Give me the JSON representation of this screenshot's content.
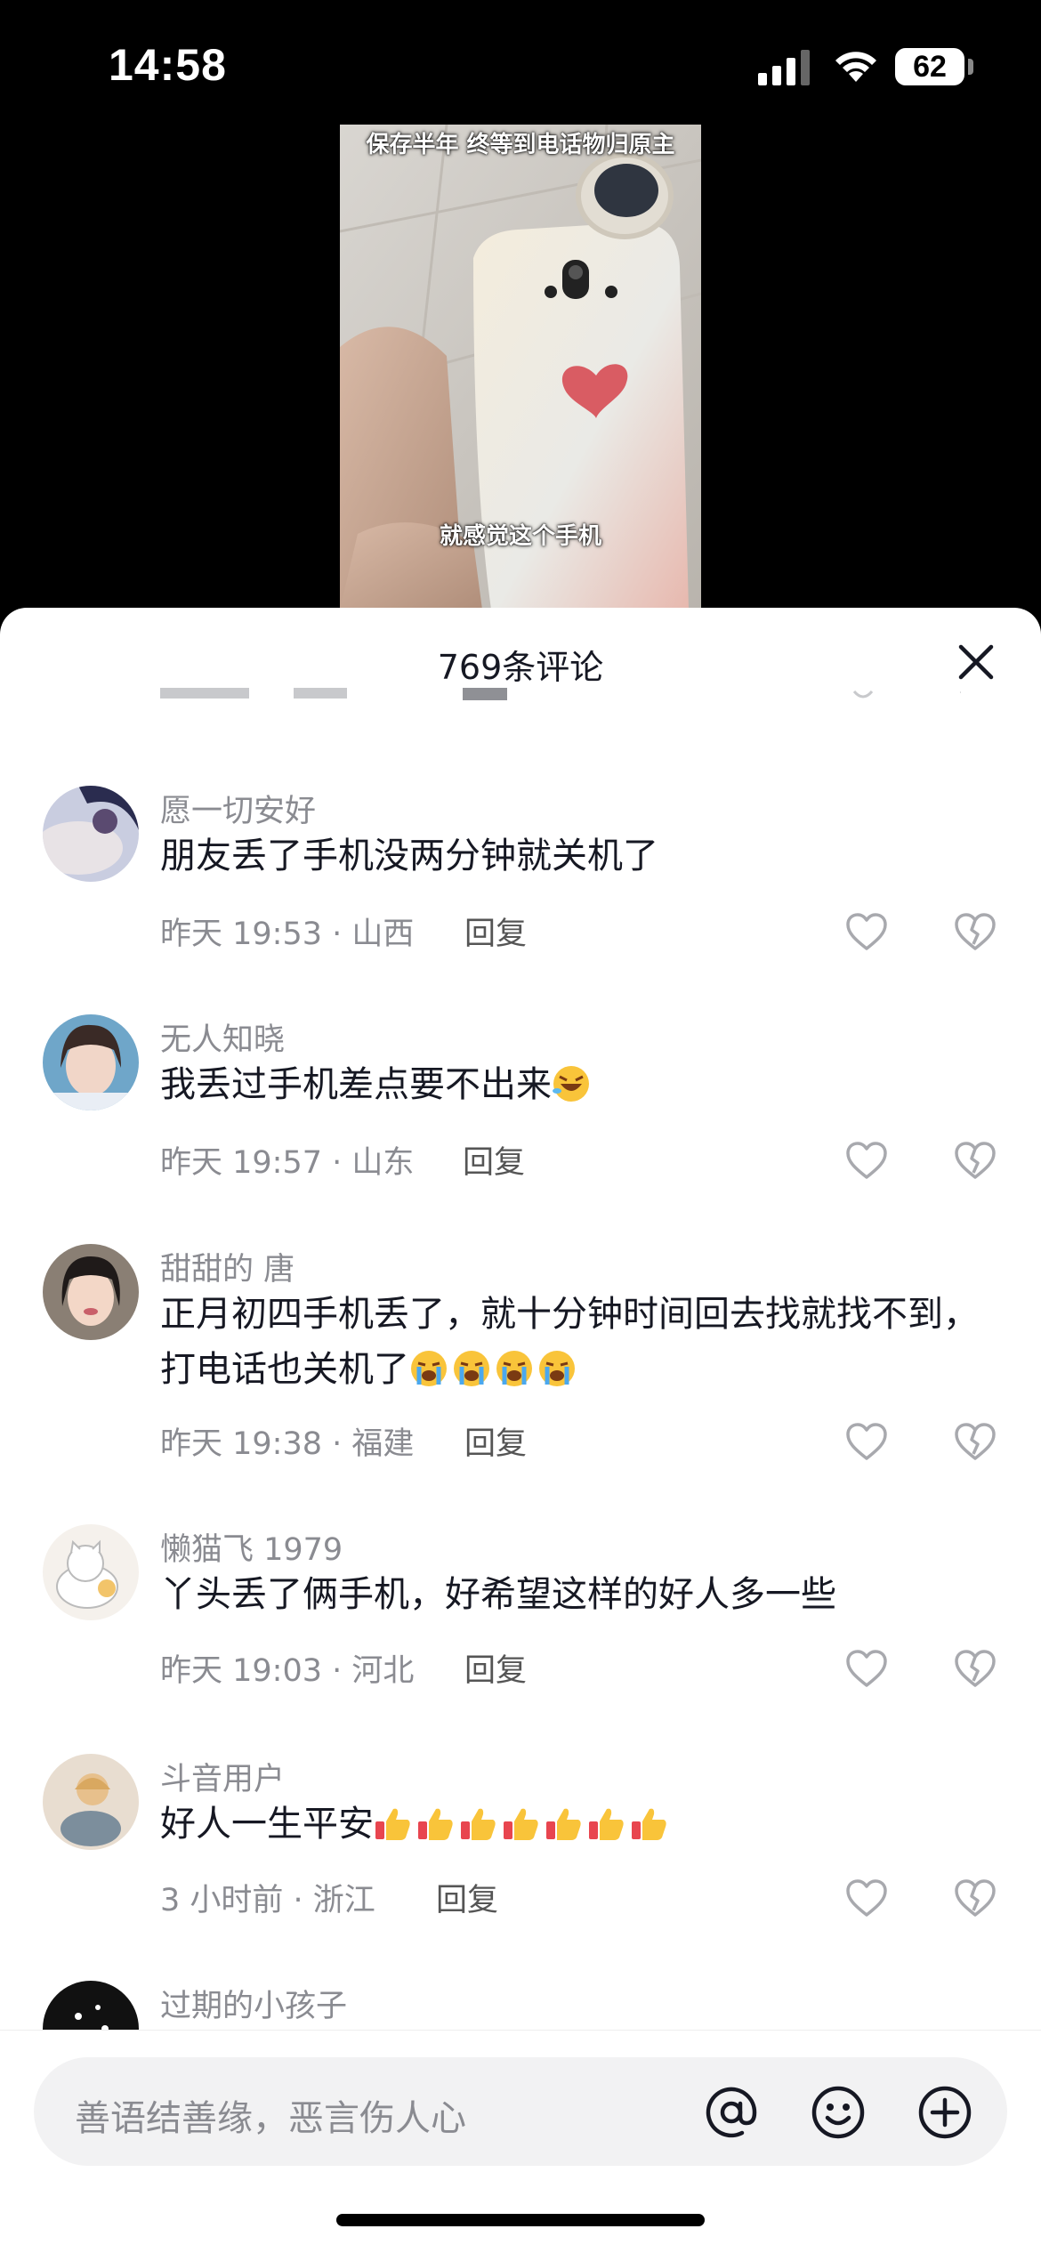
{
  "status_bar": {
    "time": "14:58",
    "battery": "62"
  },
  "video": {
    "caption_top": "保存半年 终等到电话物归原主",
    "caption_bottom": "就感觉这个手机"
  },
  "comments_panel": {
    "title": "769条评论",
    "comments": [
      {
        "user": "愿一切安好",
        "text": "朋友丢了手机没两分钟就关机了",
        "emojis": [],
        "meta": "昨天 19:53 · 山西",
        "reply": "回复"
      },
      {
        "user": "无人知晓",
        "text": "我丢过手机差点要不出来",
        "emojis": [
          "rofl"
        ],
        "meta": "昨天 19:57 · 山东",
        "reply": "回复"
      },
      {
        "user": "甜甜的 唐",
        "text": "正月初四手机丢了，就十分钟时间回去找就找不到，打电话也关机了",
        "emojis": [
          "cry",
          "cry",
          "cry",
          "cry"
        ],
        "meta": "昨天 19:38 · 福建",
        "reply": "回复"
      },
      {
        "user": "懒猫飞 1979",
        "text": "丫头丢了俩手机，好希望这样的好人多一些",
        "emojis": [],
        "meta": "昨天 19:03 · 河北",
        "reply": "回复"
      },
      {
        "user": "斗音用户",
        "text": "好人一生平安",
        "emojis": [
          "thumbs-up",
          "thumbs-up",
          "thumbs-up",
          "thumbs-up",
          "thumbs-up",
          "thumbs-up",
          "thumbs-up"
        ],
        "meta": "3 小时前 · 浙江",
        "reply": "回复"
      },
      {
        "user": "过期的小孩子",
        "text": "",
        "emojis": [],
        "meta": "",
        "reply": ""
      }
    ]
  },
  "input": {
    "placeholder": "善语结善缘，恶言伤人心"
  },
  "icons": {
    "at": "at-icon",
    "emoji": "emoji-icon",
    "add": "add-icon",
    "like": "heart-icon",
    "dislike": "broken-heart-icon",
    "close": "close-icon"
  }
}
